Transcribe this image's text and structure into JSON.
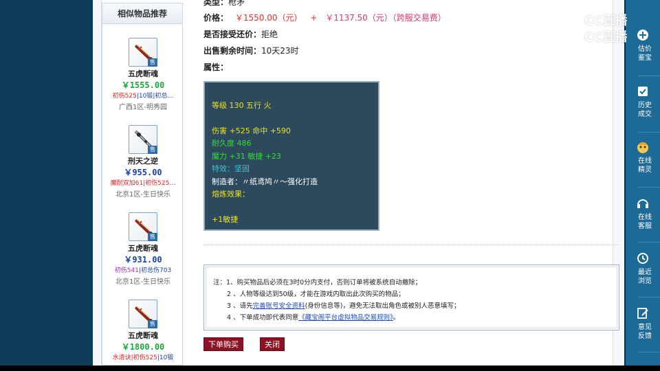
{
  "sidebar": {
    "title": "相似物品推荐",
    "items": [
      {
        "name": "五虎断魂",
        "price": "￥1555.00",
        "price_color": "#1aa63a",
        "attrs": [
          {
            "text": "初伤525",
            "cls": "red"
          },
          {
            "text": "|10锻",
            "cls": "blue"
          },
          {
            "text": "|初总…",
            "cls": "blue"
          }
        ],
        "server": "广西1区-明秀园",
        "icon": "saber-icon"
      },
      {
        "name": "刑天之逆",
        "price": "￥955.00",
        "price_color": "#1b3fa8",
        "attrs": [
          {
            "text": "魔耐双加61",
            "cls": "red"
          },
          {
            "text": "|初伤525…",
            "cls": "red"
          }
        ],
        "server": "北京1区-生日快乐",
        "icon": "spear-icon"
      },
      {
        "name": "五虎断魂",
        "price": "￥931.00",
        "price_color": "#1b3fa8",
        "attrs": [
          {
            "text": "初伤541",
            "cls": "purple"
          },
          {
            "text": "|初总伤703",
            "cls": "blue"
          }
        ],
        "server": "北京1区-生日快乐",
        "icon": "saber-icon"
      },
      {
        "name": "五虎断魂",
        "price": "￥1800.00",
        "price_color": "#1aa63a",
        "attrs": [
          {
            "text": "水清诀",
            "cls": "red"
          },
          {
            "text": "|初伤525",
            "cls": "red"
          },
          {
            "text": "|10锻",
            "cls": "blue"
          }
        ],
        "server": "",
        "icon": "saber-icon"
      }
    ],
    "sale_tag": "售"
  },
  "details": {
    "type_label": "类型：",
    "type_value": "枪矛",
    "price_label": "价格：",
    "price_main": "￥1550.00（元）",
    "price_plus": "+",
    "price_fee": "￥1137.50（元）（跨服交易费）",
    "bargain_label": "是否接受还价：",
    "bargain_value": "拒绝",
    "remaining_label": "出售剩余时间：",
    "remaining_value": "10天23时",
    "attributes_label": "属性："
  },
  "stats": {
    "level_line": "等级 130 五行 火",
    "damage_line": "伤害 +525 命中 +590",
    "durability_line": "耐久度 486",
    "magic_line": "魔力 +31 敏捷 +23",
    "effect_line": "特效：坚固",
    "maker_line": "制造者：〃纸鸢鸠〃～强化打造",
    "smelt_label": "熔炼效果：",
    "smelt_value": "+1敏捷"
  },
  "notice": {
    "prefix": "注：1、购买物品后必须在3时0分内支付，否则订单将被系统自动撤除；",
    "line2": "2 、人物等级达到50级，才能在游戏内取出此次购买的物品；",
    "line3_pre": "3 、请先",
    "line3_link": "完善账号安全资料",
    "line3_post": "(身份信息等)，避免无法取出角色或被别人恶意填写；",
    "line4_pre": "4 、下单成功即代表同意",
    "line4_link": "《藏宝阁平台虚拟物品交易规则》",
    "line4_post": "。"
  },
  "actions": {
    "buy": "下单购买",
    "close": "关闭"
  },
  "right_panel": {
    "items": [
      {
        "text1": "估价",
        "text2": "鉴宝",
        "icon": "plus-icon"
      },
      {
        "text1": "历史",
        "text2": "成交",
        "icon": "check-icon"
      },
      {
        "text1": "在线",
        "text2": "精灵",
        "icon": "mascot-icon"
      },
      {
        "text1": "在线",
        "text2": "客服",
        "icon": "headset-icon"
      },
      {
        "text1": "最近",
        "text2": "浏览",
        "icon": "clock-icon"
      },
      {
        "text1": "意见",
        "text2": "反馈",
        "icon": "edit-icon"
      }
    ]
  },
  "watermark": {
    "text": "CC直播"
  }
}
